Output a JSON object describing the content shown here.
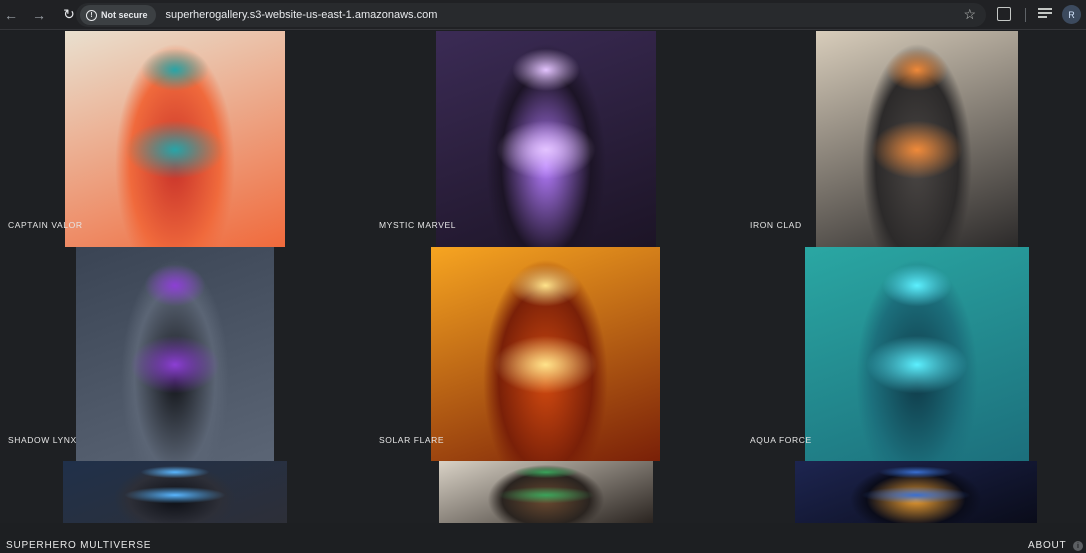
{
  "browser": {
    "security_label": "Not secure",
    "url": "superherogallery.s3-website-us-east-1.amazonaws.com",
    "profile_initial": "R",
    "icons": [
      "back-arrow-icon",
      "forward-arrow-icon",
      "reload-icon",
      "warning-icon",
      "star-icon",
      "extensions-icon",
      "media-controls-icon"
    ]
  },
  "gallery": {
    "items": [
      {
        "name": "CAPTAIN VALOR",
        "palette": [
          "#e9e0cf",
          "#c8322a",
          "#27a5a8",
          "#f06a3c"
        ]
      },
      {
        "name": "MYSTIC MARVEL",
        "palette": [
          "#3b2b55",
          "#b57cff",
          "#e3c3ff",
          "#1c1426"
        ]
      },
      {
        "name": "IRON CLAD",
        "palette": [
          "#d8cdbb",
          "#4a4644",
          "#f08a3a",
          "#2c2a2a"
        ]
      },
      {
        "name": "SHADOW LYNX",
        "palette": [
          "#3a4454",
          "#121418",
          "#8c3fd4",
          "#5b6575"
        ]
      },
      {
        "name": "SOLAR FLARE",
        "palette": [
          "#f7a521",
          "#d24a10",
          "#ffe38a",
          "#7a2008"
        ]
      },
      {
        "name": "AQUA FORCE",
        "palette": [
          "#2aa7a3",
          "#0f3a48",
          "#5cf0ff",
          "#1c6f7c"
        ]
      },
      {
        "name": "",
        "palette": [
          "#20304a",
          "#0c0e14",
          "#59b6ff",
          "#2d2f38"
        ]
      },
      {
        "name": "",
        "palette": [
          "#d9d2c6",
          "#6b4a30",
          "#3aa35a",
          "#2a2420"
        ]
      },
      {
        "name": "",
        "palette": [
          "#1d2550",
          "#f0a030",
          "#3a6fd0",
          "#0a0c1a"
        ]
      }
    ]
  },
  "footer": {
    "brand": "SUPERHERO MULTIVERSE",
    "about": "ABOUT",
    "info_glyph": "i"
  }
}
